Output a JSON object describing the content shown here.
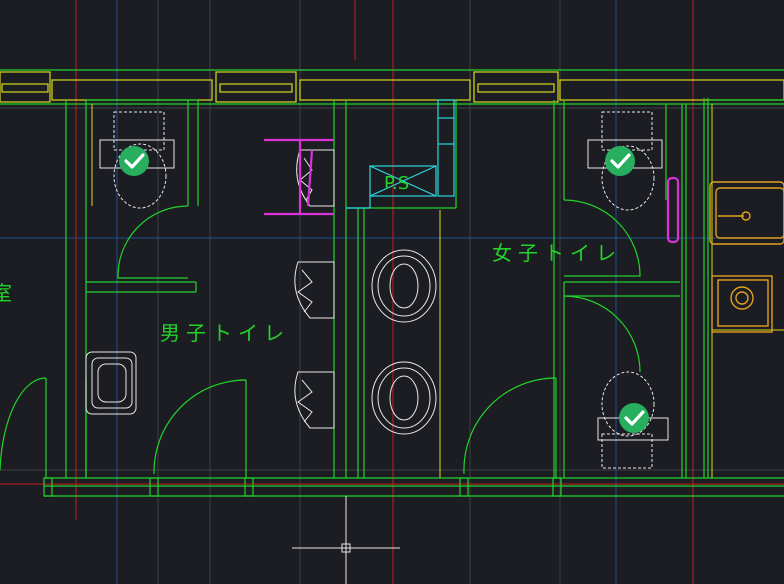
{
  "drawing": {
    "background": "#1c1d22",
    "colors": {
      "wall": "#22d32a",
      "fixture": "#e8e8e8",
      "window": "#d8d820",
      "grid_red": "#c8191e",
      "grid_blue": "#1f4f8f",
      "grid_gray": "#3b3e47",
      "ps": "#2ad8e0",
      "rail": "#d832d8",
      "kitchen": "#e0a020",
      "badge": "#27ae5f",
      "label": "#22d32a"
    },
    "labels": {
      "mens_room": "男子トイレ",
      "womens_room": "女子トイレ",
      "pipe_space": "P.S",
      "left_room_fragment": "室"
    },
    "markers": {
      "check_icon": "check-icon"
    }
  }
}
